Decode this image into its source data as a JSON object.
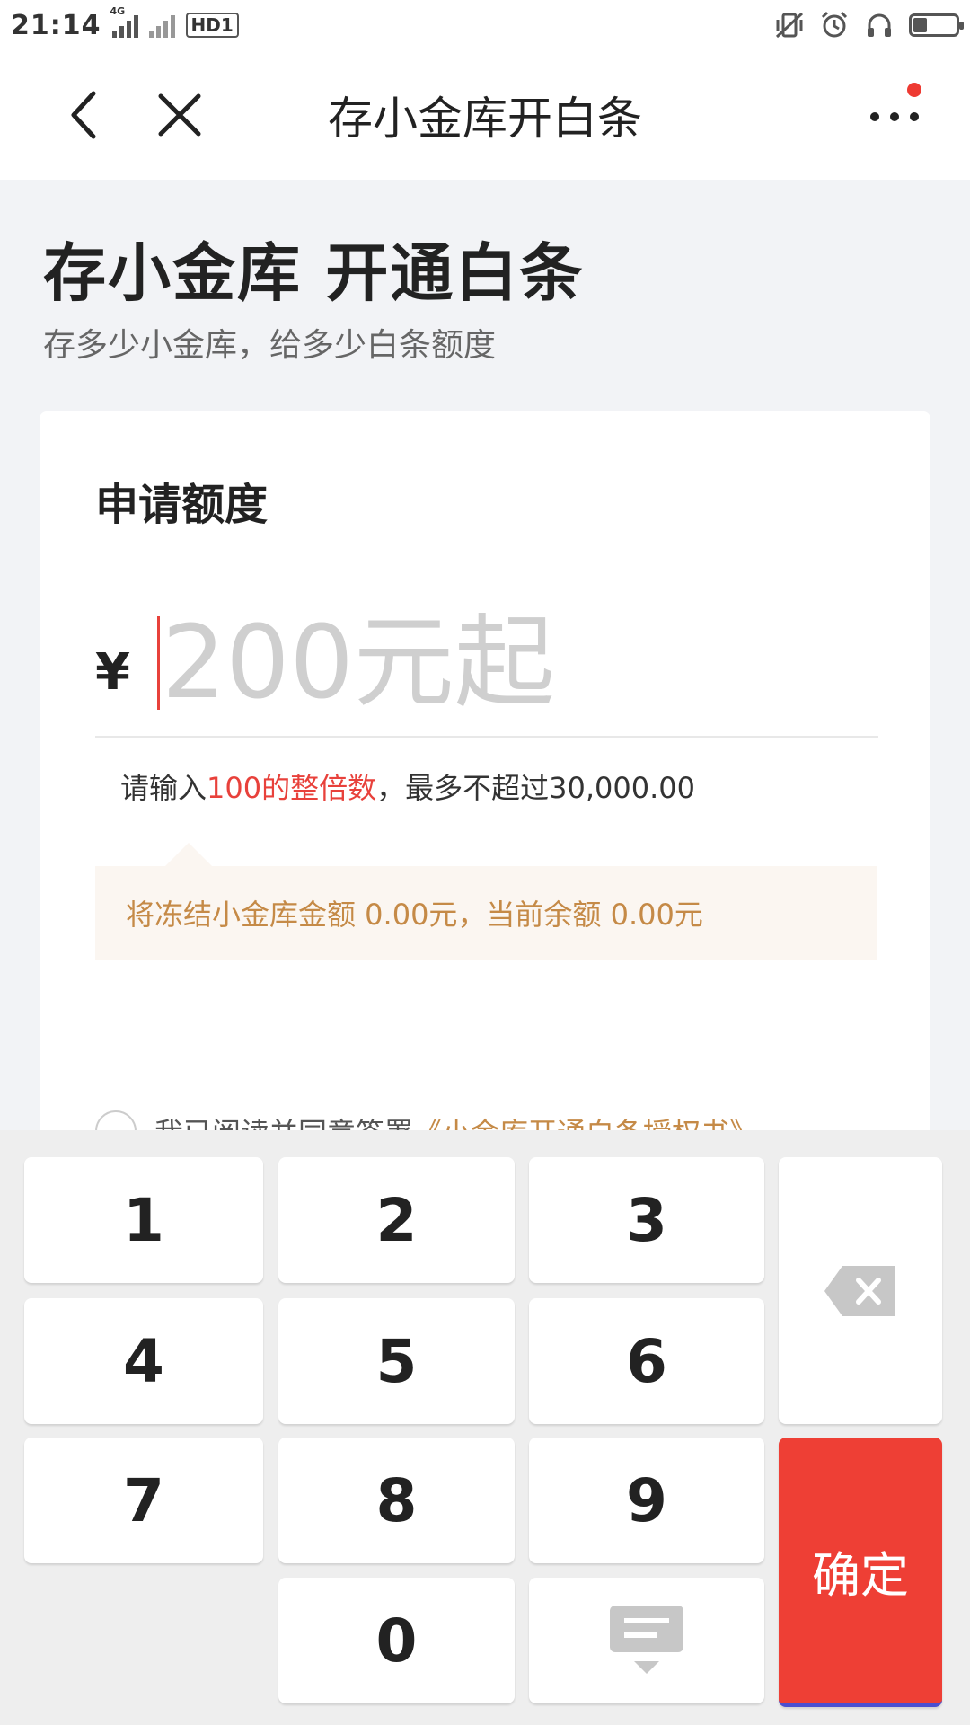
{
  "status_bar": {
    "time": "21:14",
    "network": "4G",
    "hd": "HD1",
    "battery_level": 0.3
  },
  "nav": {
    "title": "存小金库开白条",
    "back_icon": "chevron-left-icon",
    "close_icon": "close-icon",
    "more_icon": "more-dots-icon"
  },
  "hero": {
    "title": "存小金库 开通白条",
    "subtitle": "存多少小金库，给多少白条额度"
  },
  "card": {
    "title": "申请额度",
    "currency": "¥",
    "amount_placeholder": "200元起",
    "amount_value": "",
    "hint_prefix": "请输入",
    "hint_highlight": "100的整倍数",
    "hint_suffix": "，最多不超过30,000.00",
    "notice": "将冻结小金库金额 0.00元，当前余额 0.00元",
    "agree_text": "我已阅读并同意签署",
    "agree_link": "《小金库开通白条授权书》"
  },
  "keypad": {
    "keys": [
      "1",
      "2",
      "3",
      "4",
      "5",
      "6",
      "7",
      "8",
      "9",
      "0"
    ],
    "confirm_label": "确定",
    "delete_icon": "backspace-icon",
    "hide_icon": "keyboard-hide-icon"
  },
  "colors": {
    "accent_red": "#ee3f35",
    "notice_text": "#c58a47",
    "notice_bg": "#fbf6f1"
  }
}
